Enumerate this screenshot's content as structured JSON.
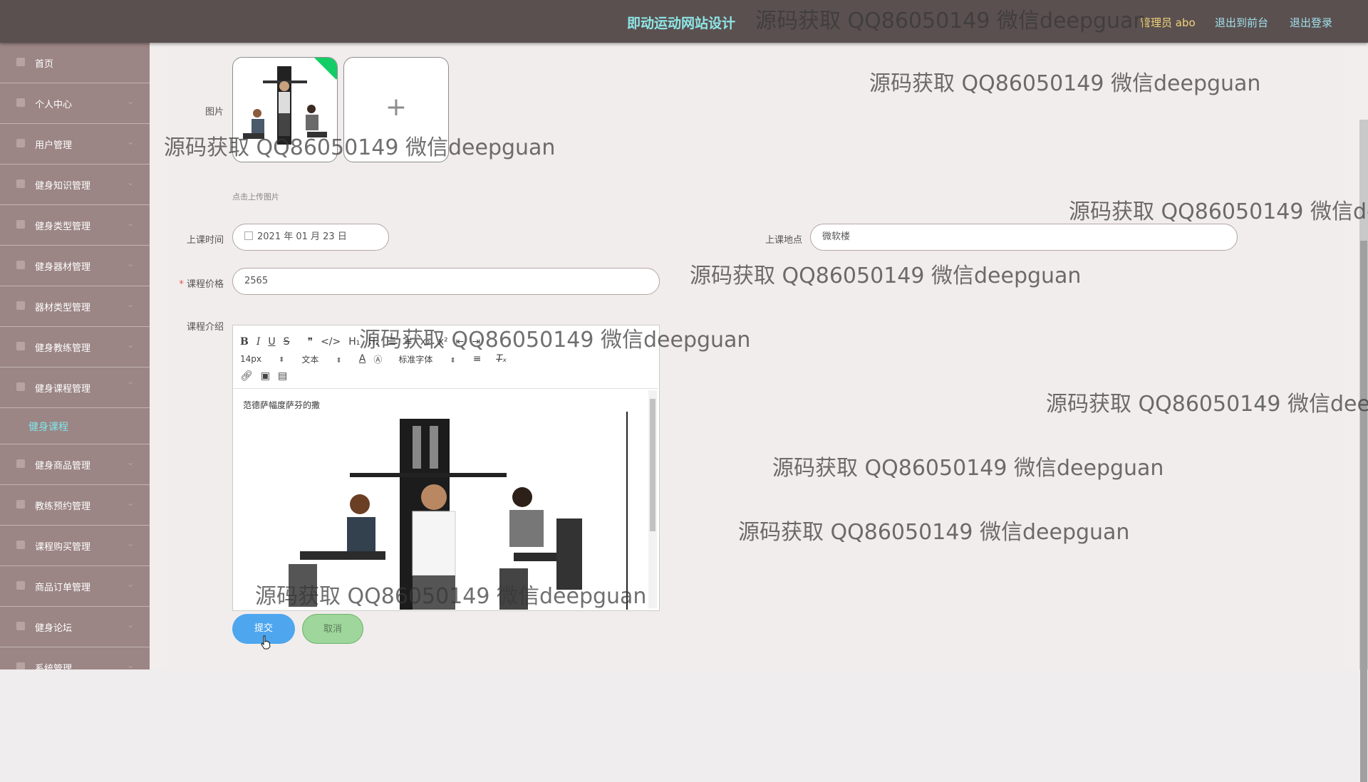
{
  "header": {
    "title": "即动运动网站设计",
    "admin_label": "管理员 abo",
    "front_link": "退出到前台",
    "logout_link": "退出登录"
  },
  "sidebar": {
    "items": [
      {
        "label": "首页",
        "icon": "home-icon"
      },
      {
        "label": "个人中心",
        "icon": "user-icon"
      },
      {
        "label": "用户管理",
        "icon": "grid-icon"
      },
      {
        "label": "健身知识管理",
        "icon": "cart-icon"
      },
      {
        "label": "健身类型管理",
        "icon": "trophy-icon"
      },
      {
        "label": "健身器材管理",
        "icon": "user-icon"
      },
      {
        "label": "器材类型管理",
        "icon": "chart-icon"
      },
      {
        "label": "健身教练管理",
        "icon": "clock-icon"
      },
      {
        "label": "健身课程管理",
        "icon": "book-icon"
      }
    ],
    "active_sub": "健身课程",
    "items_after": [
      {
        "label": "健身商品管理",
        "icon": "flag-icon"
      },
      {
        "label": "教练预约管理",
        "icon": "list-icon"
      },
      {
        "label": "课程购买管理",
        "icon": "clock-icon"
      },
      {
        "label": "商品订单管理",
        "icon": "cart-icon"
      },
      {
        "label": "健身论坛",
        "icon": "cart-icon"
      },
      {
        "label": "系统管理",
        "icon": "gear-icon"
      }
    ]
  },
  "form": {
    "image_label": "图片",
    "upload_hint": "点击上传图片",
    "time_label": "上课时间",
    "time_value": "2021 年 01 月 23 日",
    "place_label": "上课地点",
    "place_value": "微软楼",
    "price_required": "*",
    "price_label": "课程价格",
    "price_value": "2565",
    "intro_label": "课程介绍",
    "editor": {
      "font_size": "14px",
      "paragraph": "文本",
      "font_family": "标准字体",
      "content_text": "范德萨幅度萨芬的撒"
    },
    "submit_label": "提交",
    "cancel_label": "取消"
  },
  "watermark": "源码获取 QQ86050149 微信deepguan"
}
